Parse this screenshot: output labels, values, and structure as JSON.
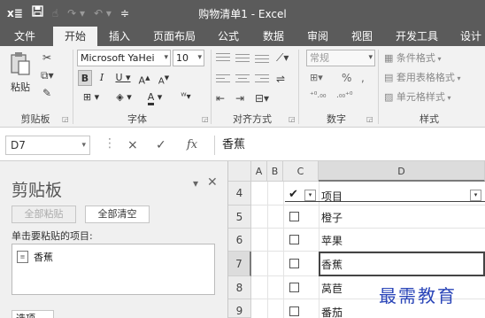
{
  "titlebar": {
    "app_icon": "x≣",
    "title": "购物清单1 - Excel",
    "qat_icons": [
      "save-icon",
      "touch-mode-icon",
      "redo-icon",
      "undo-icon",
      "customize-qat-icon"
    ]
  },
  "tabs": [
    "文件",
    "开始",
    "插入",
    "页面布局",
    "公式",
    "数据",
    "审阅",
    "视图",
    "开发工具",
    "设计"
  ],
  "active_tab": "开始",
  "ribbon": {
    "clipboard": {
      "label": "剪贴板",
      "paste": "粘贴"
    },
    "font": {
      "label": "字体",
      "name": "Microsoft YaHei",
      "size": "10"
    },
    "alignment": {
      "label": "对齐方式"
    },
    "number": {
      "label": "数字",
      "format": "常规"
    },
    "styles": {
      "label": "样式",
      "conditional": "条件格式",
      "table": "套用表格格式",
      "cell": "单元格样式"
    }
  },
  "formula_bar": {
    "name_box": "D7",
    "cancel": "×",
    "enter": "✓",
    "fx": "fx",
    "value": "香蕉"
  },
  "clipboard_pane": {
    "title": "剪贴板",
    "paste_all": "全部粘贴",
    "clear_all": "全部清空",
    "hint": "单击要粘贴的项目:",
    "items": [
      "香蕉"
    ],
    "options": "选项"
  },
  "grid": {
    "columns": [
      "A",
      "B",
      "C",
      "D"
    ],
    "selected_column": "D",
    "header_row": {
      "number": "4",
      "check": "✔",
      "label": "项目"
    },
    "rows": [
      {
        "number": "5",
        "item": "橙子"
      },
      {
        "number": "6",
        "item": "苹果"
      },
      {
        "number": "7",
        "item": "香蕉"
      },
      {
        "number": "8",
        "item": "莴苣"
      },
      {
        "number": "9",
        "item": "番茄"
      }
    ],
    "selected_row": "7"
  },
  "watermark": "最需教育"
}
